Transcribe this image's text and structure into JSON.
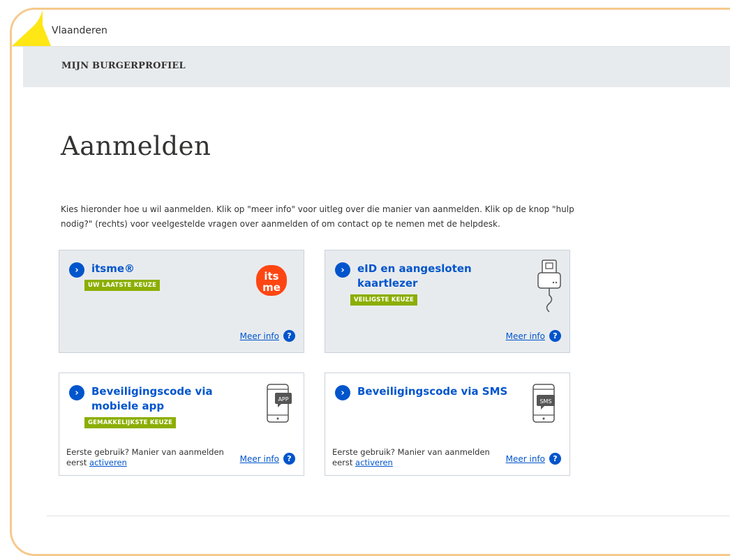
{
  "header": {
    "brand": "Vlaanderen",
    "subtitle": "MIJN BURGERPROFIEL"
  },
  "page": {
    "title": "Aanmelden",
    "intro": "Kies hieronder hoe u wil aanmelden. Klik op \"meer info\" voor uitleg over die manier van aanmelden. Klik op de knop \"hulp nodig?\" (rechts) voor veelgestelde vragen over aanmelden of om contact op te nemen met de helpdesk."
  },
  "options": [
    {
      "title": "itsme®",
      "badge": "UW LAATSTE KEUZE",
      "more_info": "Meer info",
      "icon": "itsme-logo"
    },
    {
      "title": "eID en aangesloten kaartlezer",
      "badge": "VEILIGSTE KEUZE",
      "more_info": "Meer info",
      "icon": "card-reader-icon"
    },
    {
      "title": "Beveiligingscode via mobiele app",
      "badge": "GEMAKKELIJKSTE KEUZE",
      "more_info": "Meer info",
      "icon": "phone-app-icon",
      "first_use": "Eerste gebruik? Manier van aanmelden eerst",
      "activate": "activeren",
      "icon_label": "APP"
    },
    {
      "title": "Beveiligingscode via SMS",
      "more_info": "Meer info",
      "icon": "phone-sms-icon",
      "first_use": "Eerste gebruik? Manier van aanmelden eerst",
      "activate": "activeren",
      "icon_label": "SMS"
    }
  ],
  "logo_text": {
    "line1": "its",
    "line2": "me"
  },
  "colors": {
    "accent": "#0055cc",
    "badge": "#8bae00",
    "itsme": "#ff4612",
    "flag": "#ffe615"
  }
}
